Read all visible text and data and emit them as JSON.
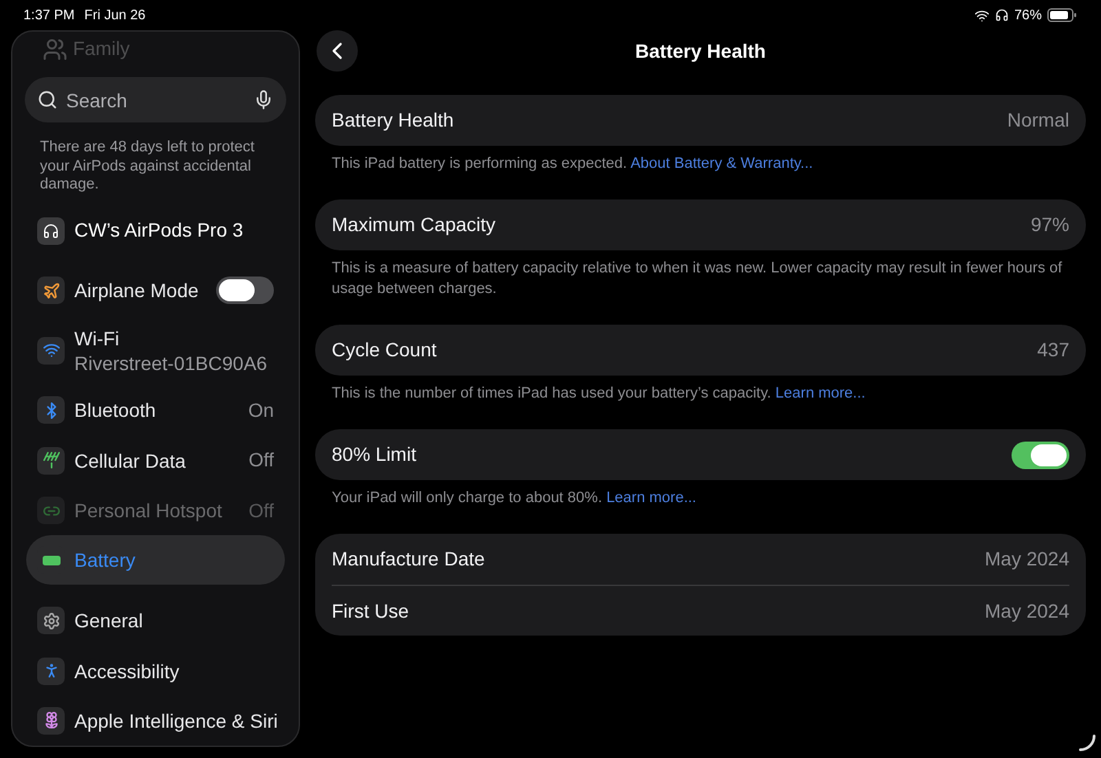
{
  "status_bar": {
    "time": "1:37 PM",
    "date": "Fri Jun 26",
    "battery": "76%"
  },
  "sidebar": {
    "family": "Family",
    "search": {
      "placeholder": "Search"
    },
    "notice": "There are 48 days left to protect your AirPods against accidental damage.",
    "airpods": "CW’s AirPods Pro 3",
    "items": [
      {
        "kind": "toggle",
        "label": "Airplane Mode",
        "on": false,
        "selected": false,
        "disabled": false
      },
      {
        "kind": "value",
        "label": "Wi-Fi",
        "subtitle": "Riverstreet-01BC90A6",
        "selected": false,
        "disabled": false
      },
      {
        "kind": "value",
        "label": "Bluetooth",
        "value": "On",
        "selected": false,
        "disabled": false
      },
      {
        "kind": "value",
        "label": "Cellular Data",
        "value": "Off",
        "selected": false,
        "disabled": false
      },
      {
        "kind": "value",
        "label": "Personal Hotspot",
        "value": "Off",
        "selected": false,
        "disabled": true
      },
      {
        "kind": "value",
        "label": "Battery",
        "selected": true,
        "disabled": false
      },
      {
        "kind": "gap"
      },
      {
        "kind": "value",
        "label": "General",
        "selected": false,
        "disabled": false
      },
      {
        "kind": "value",
        "label": "Accessibility",
        "selected": false,
        "disabled": false
      },
      {
        "kind": "value",
        "label": "Apple Intelligence & Siri",
        "selected": false,
        "disabled": false
      }
    ]
  },
  "detail": {
    "title": "Battery Health",
    "groups": [
      {
        "rows": [
          {
            "kind": "value",
            "label": "Battery Health",
            "value": "Normal"
          }
        ],
        "footer": {
          "text": "This iPad battery is performing as expected.",
          "link": "About Battery & Warranty..."
        }
      },
      {
        "rows": [
          {
            "kind": "value",
            "label": "Maximum Capacity",
            "value": "97%"
          }
        ],
        "footer": {
          "text": "This is a measure of battery capacity relative to when it was new. Lower capacity may result in fewer hours of usage between charges."
        }
      },
      {
        "rows": [
          {
            "kind": "value",
            "label": "Cycle Count",
            "value": "437"
          }
        ],
        "footer": {
          "text": "This is the number of times iPad has used your battery’s capacity.",
          "link": "Learn more..."
        }
      },
      {
        "rows": [
          {
            "kind": "toggle",
            "label": "80% Limit",
            "on": true
          }
        ],
        "footer": {
          "text": "Your iPad will only charge to about 80%.",
          "link": "Learn more..."
        }
      },
      {
        "rows": [
          {
            "kind": "value",
            "label": "Manufacture Date",
            "value": "May 2024"
          },
          {
            "kind": "value",
            "label": "First Use",
            "value": "May 2024"
          }
        ]
      }
    ]
  }
}
